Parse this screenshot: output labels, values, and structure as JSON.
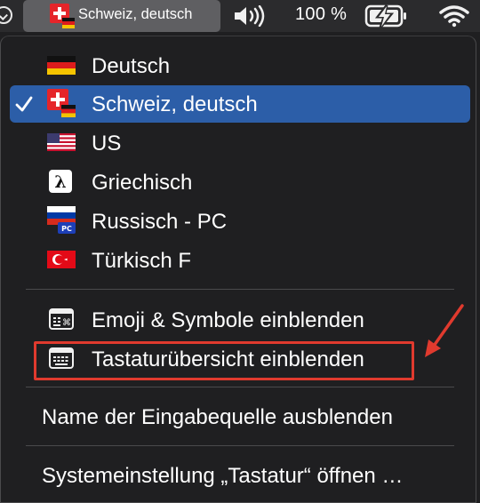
{
  "menubar": {
    "input_source": "Schweiz, deutsch",
    "battery_percent": "100 %",
    "icons": [
      "checkmark-circle-icon",
      "swiss-german-flag-icon",
      "volume-icon",
      "battery-charging-icon",
      "wifi-icon"
    ]
  },
  "menu": {
    "sources": [
      {
        "label": "Deutsch",
        "icon": "german-flag-icon",
        "selected": false
      },
      {
        "label": "Schweiz, deutsch",
        "icon": "swiss-german-flag-icon",
        "selected": true
      },
      {
        "label": "US",
        "icon": "us-flag-icon",
        "selected": false
      },
      {
        "label": "Griechisch",
        "icon": "lambda-icon",
        "selected": false
      },
      {
        "label": "Russisch - PC",
        "icon": "russian-pc-flag-icon",
        "selected": false
      },
      {
        "label": "Türkisch F",
        "icon": "turkish-flag-icon",
        "selected": false
      }
    ],
    "emoji_label": "Emoji & Symbole einblenden",
    "keyboard_viewer_label": "Tastaturübersicht einblenden",
    "hide_input_name_label": "Name der Eingabequelle ausblenden",
    "open_prefs_label": "Systemeinstellung „Tastatur“ öffnen …"
  },
  "colors": {
    "selection": "#2c5ea8",
    "annotation": "#e03a2e",
    "background": "#1f1f21"
  }
}
